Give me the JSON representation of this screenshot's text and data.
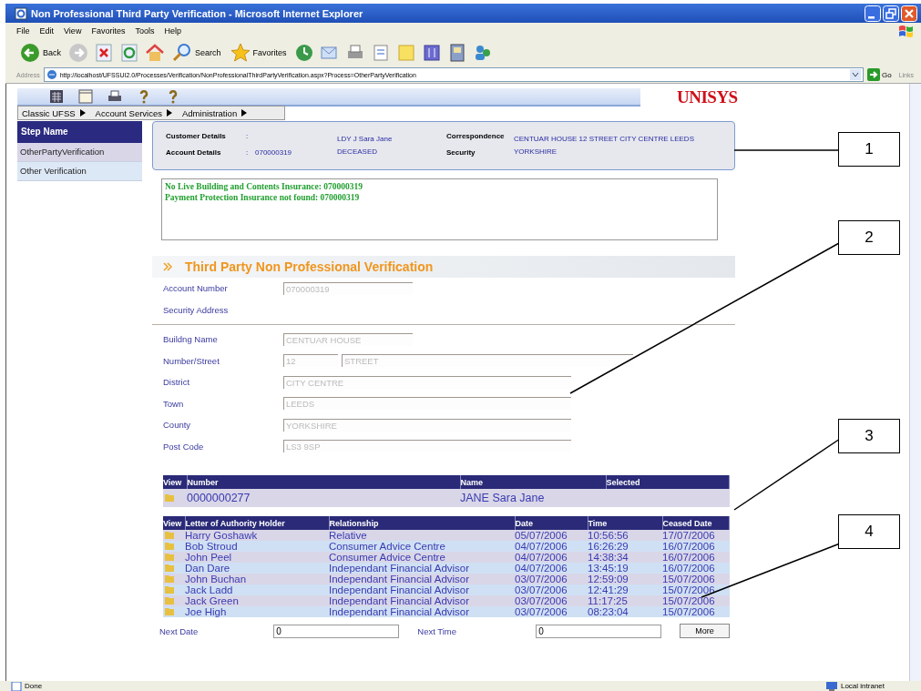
{
  "window": {
    "title": "Non Professional Third Party Verification - Microsoft Internet Explorer"
  },
  "menu_bar": [
    "File",
    "Edit",
    "View",
    "Favorites",
    "Tools",
    "Help"
  ],
  "toolbar": [
    {
      "kind": "back",
      "label": "Back"
    },
    {
      "kind": "forward"
    },
    {
      "kind": "stop"
    },
    {
      "kind": "refresh"
    },
    {
      "kind": "home"
    },
    {
      "kind": "search",
      "label": "Search"
    },
    {
      "kind": "favorites",
      "label": "Favorites"
    },
    {
      "kind": "history"
    },
    {
      "kind": "mail"
    },
    {
      "kind": "print"
    },
    {
      "kind": "edit"
    },
    {
      "kind": "note"
    },
    {
      "kind": "messenger"
    },
    {
      "kind": "research"
    },
    {
      "kind": "people"
    }
  ],
  "address_bar": {
    "label": "Address",
    "url": "http://localhost/UFSSUI2.0/Processes/Verification/NonProfessionalThirdPartyVerification.aspx?Process=OtherPartyVerification",
    "go": "Go",
    "links": "Links"
  },
  "app_toolbar": [
    {
      "kind": "calculator"
    },
    {
      "kind": "window"
    },
    {
      "kind": "print"
    },
    {
      "kind": "help"
    },
    {
      "kind": "help"
    }
  ],
  "logo": "UNISYS",
  "nav_menu": [
    "Classic UFSS",
    "Account Services",
    "Administration"
  ],
  "sidebar": {
    "header": "Step Name",
    "items": [
      {
        "label": "OtherPartyVerification",
        "selected": true
      },
      {
        "label": "Other Verification",
        "selected": false
      }
    ]
  },
  "customer_panel": {
    "customer_details_label": "Customer Details",
    "customer_details_colon": ":",
    "account_details_label": "Account Details",
    "account_details_colon": ":",
    "account_number": "070000319",
    "name": "LDY J Sara Jane",
    "status": "DECEASED",
    "correspondence_label": "Correspondence",
    "security_label": "Security",
    "address_line_1": "CENTUAR HOUSE 12 STREET CITY CENTRE LEEDS",
    "address_line_2": "YORKSHIRE"
  },
  "messages": [
    "No Live Building and Contents Insurance: 070000319",
    "Payment Protection Insurance not found: 070000319"
  ],
  "section_title": "Third Party Non Professional Verification",
  "account_fields": [
    {
      "label": "Account Number",
      "values": [
        "070000319"
      ],
      "disabled": true
    },
    {
      "label": "Security Address"
    }
  ],
  "address_fields": [
    {
      "label": "Buildng Name",
      "values": [
        "CENTUAR HOUSE"
      ],
      "disabled": true
    },
    {
      "label": "Number/Street",
      "values": [
        "12",
        "STREET"
      ],
      "disabled": true
    },
    {
      "label": "District",
      "values": [
        "CITY CENTRE"
      ],
      "disabled": true
    },
    {
      "label": "Town",
      "values": [
        "LEEDS"
      ],
      "disabled": true
    },
    {
      "label": "County",
      "values": [
        "YORKSHIRE"
      ],
      "disabled": true
    },
    {
      "label": "Post Code",
      "values": [
        "LS3 9SP"
      ],
      "disabled": true
    }
  ],
  "parties_table": {
    "columns": [
      "View",
      "Number",
      "Name",
      "Selected"
    ],
    "rows": [
      [
        "",
        "0000000277",
        "JANE Sara Jane",
        ""
      ]
    ]
  },
  "authority_table": {
    "columns": [
      "View",
      "Letter of Authority Holder",
      "Relationship",
      "Date",
      "Time",
      "Ceased Date"
    ],
    "rows": [
      [
        "",
        "Harry Goshawk",
        "Relative",
        "05/07/2006",
        "10:56:56",
        "17/07/2006"
      ],
      [
        "",
        "Bob Stroud",
        "Consumer Advice Centre",
        "04/07/2006",
        "16:26:29",
        "16/07/2006"
      ],
      [
        "",
        "John Peel",
        "Consumer Advice Centre",
        "04/07/2006",
        "14:38:34",
        "16/07/2006"
      ],
      [
        "",
        "Dan Dare",
        "Independant Financial Advisor",
        "04/07/2006",
        "13:45:19",
        "16/07/2006"
      ],
      [
        "",
        "John Buchan",
        "Independant Financial Advisor",
        "03/07/2006",
        "12:59:09",
        "15/07/2006"
      ],
      [
        "",
        "Jack Ladd",
        "Independant Financial Advisor",
        "03/07/2006",
        "12:41:29",
        "15/07/2006"
      ],
      [
        "",
        "Jack Green",
        "Independant Financial Advisor",
        "03/07/2006",
        "11:17:25",
        "15/07/2006"
      ],
      [
        "",
        "Joe High",
        "Independant Financial Advisor",
        "03/07/2006",
        "08:23:04",
        "15/07/2006"
      ]
    ]
  },
  "paging": {
    "next_date_label": "Next Date",
    "next_date": "0",
    "next_time_label": "Next Time",
    "next_time": "0",
    "more": "More"
  },
  "status_bar": {
    "status": "Done",
    "zone": "Local intranet"
  },
  "callouts": [
    "1",
    "2",
    "3",
    "4"
  ]
}
